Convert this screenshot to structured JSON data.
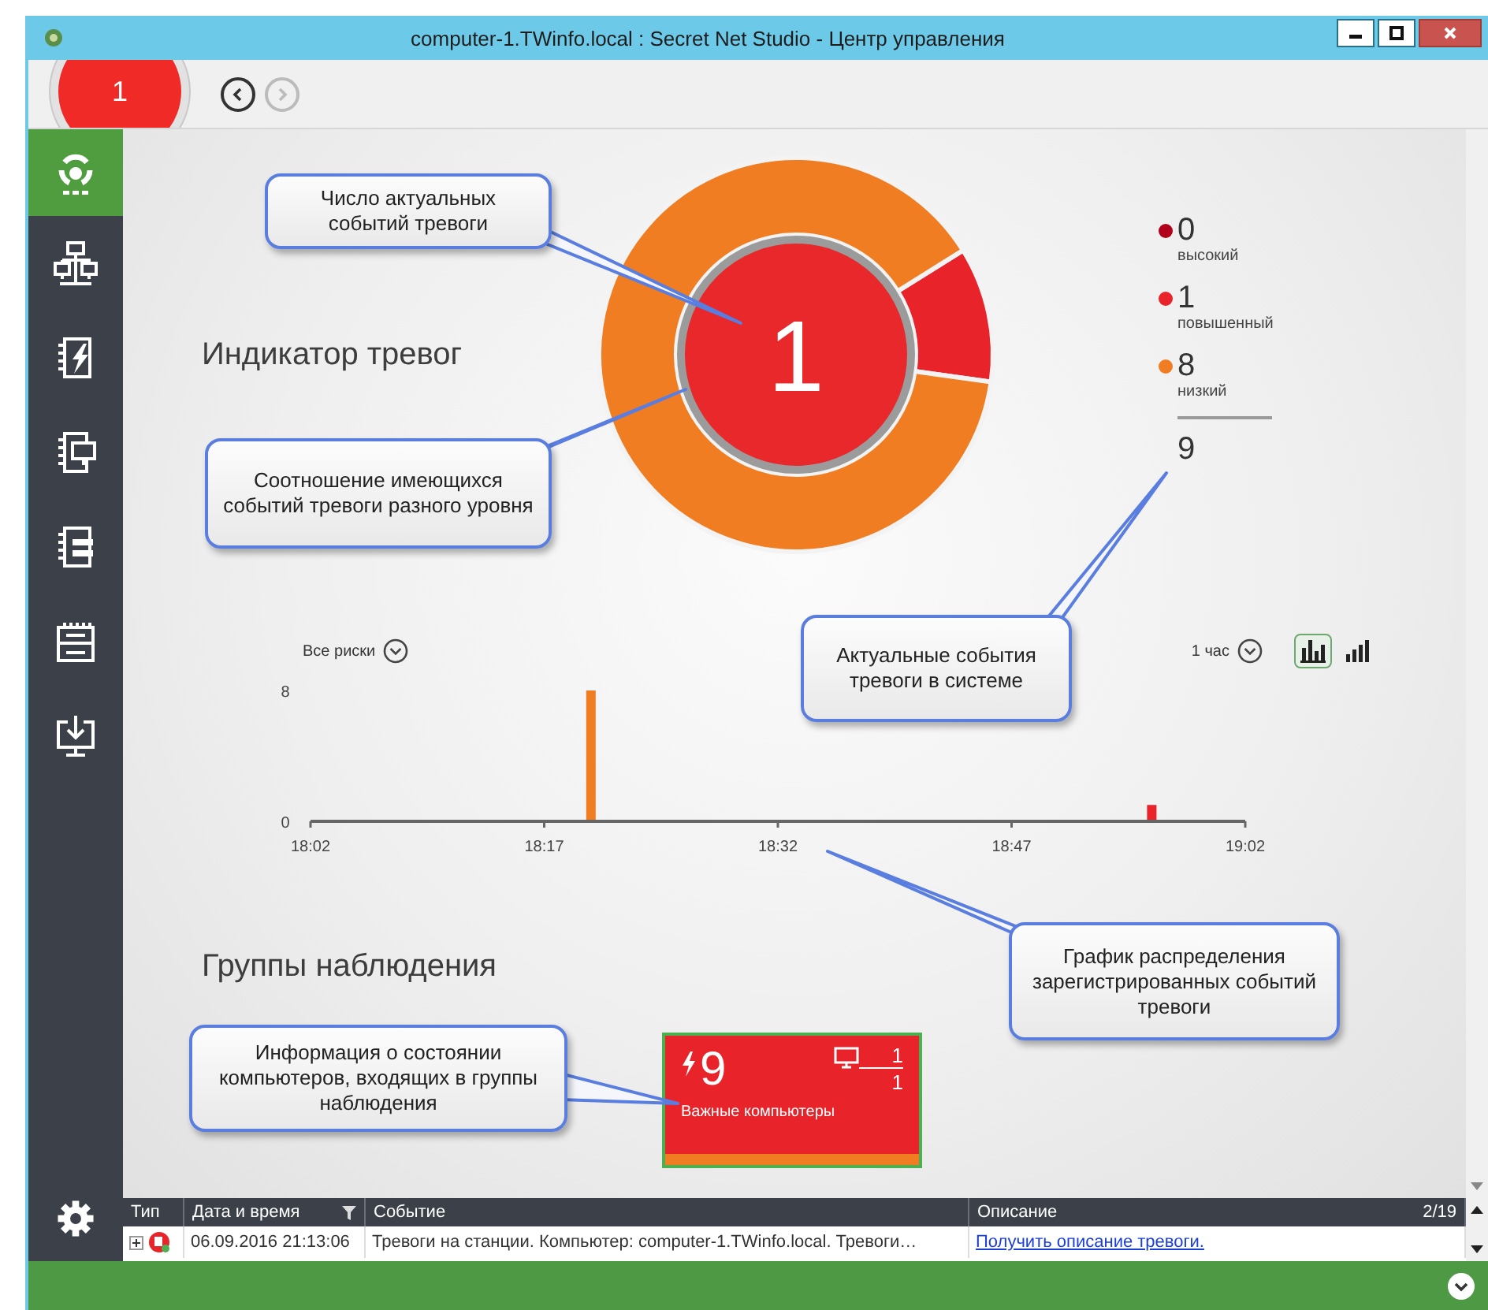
{
  "window": {
    "title": "computer-1.TWinfo.local : Secret Net Studio - Центр управления"
  },
  "toolbar": {
    "alarm_count": "1",
    "back_disabled": false,
    "forward_disabled": true
  },
  "sidebar": {
    "items": [
      {
        "kind": "dashboard",
        "selected": true
      },
      {
        "kind": "network",
        "selected": false
      },
      {
        "kind": "alarms",
        "selected": false
      },
      {
        "kind": "computers",
        "selected": false
      },
      {
        "kind": "journal",
        "selected": false
      },
      {
        "kind": "rack",
        "selected": false
      },
      {
        "kind": "install",
        "selected": false
      }
    ]
  },
  "indicator": {
    "title": "Индикатор тревог",
    "current_count": "1",
    "chart_data": {
      "type": "donut",
      "series": [
        {
          "values": [
            0,
            11.1,
            88.9
          ]
        }
      ]
    }
  },
  "legend": {
    "items": [
      {
        "count": "0",
        "label": "высокий",
        "color": "#b0001c"
      },
      {
        "count": "1",
        "label": "повышенный",
        "color": "#e8232a"
      },
      {
        "count": "8",
        "label": "низкий",
        "color": "#f07d22"
      }
    ],
    "total": "9"
  },
  "events_chart": {
    "risk_filter": "Все риски",
    "period": "1 час",
    "view_modes": [
      {
        "selected": true
      },
      {
        "selected": false
      }
    ],
    "chart_data": {
      "type": "bar",
      "categories": [
        "18:02",
        null,
        null,
        null,
        null,
        null,
        null,
        null,
        null,
        null,
        null,
        null,
        null,
        null,
        null,
        "18:17",
        null,
        null,
        null,
        null,
        null,
        null,
        null,
        null,
        null,
        null,
        null,
        null,
        null,
        null,
        "18:32",
        null,
        null,
        null,
        null,
        null,
        null,
        null,
        null,
        null,
        null,
        null,
        null,
        null,
        null,
        "18:47",
        null,
        null,
        null,
        null,
        null,
        null,
        null,
        null,
        null,
        null,
        null,
        null,
        null,
        null,
        "19:02"
      ],
      "series": [
        {
          "color": "#f07d22",
          "values": [
            null,
            null,
            null,
            null,
            null,
            null,
            null,
            null,
            null,
            null,
            null,
            null,
            null,
            null,
            null,
            null,
            null,
            null,
            8,
            null,
            null,
            null,
            null,
            null,
            null,
            null,
            null,
            null,
            null,
            null,
            null,
            null,
            null,
            null,
            null,
            null,
            null,
            null,
            null,
            null,
            null,
            null,
            null,
            null,
            null,
            null,
            null,
            null,
            null,
            null,
            null,
            null,
            null,
            null,
            null,
            null,
            null,
            null,
            null,
            null,
            null
          ]
        },
        {
          "color": "#e8232a",
          "values": [
            null,
            null,
            null,
            null,
            null,
            null,
            null,
            null,
            null,
            null,
            null,
            null,
            null,
            null,
            null,
            null,
            null,
            null,
            null,
            null,
            null,
            null,
            null,
            null,
            null,
            null,
            null,
            null,
            null,
            null,
            null,
            null,
            null,
            null,
            null,
            null,
            null,
            null,
            null,
            null,
            null,
            null,
            null,
            null,
            null,
            null,
            null,
            null,
            null,
            null,
            null,
            null,
            null,
            null,
            1,
            null,
            null,
            null,
            null,
            null,
            null
          ]
        }
      ],
      "ylim": [
        0,
        8
      ],
      "yticks": [
        0,
        8
      ],
      "stacked": true
    }
  },
  "groups": {
    "title": "Группы наблюдения",
    "tiles": [
      {
        "name": "Важные компьютеры",
        "alarms": "9",
        "computers_alarmed": "1",
        "computers_total": "1"
      }
    ]
  },
  "event_log": {
    "columns": [
      "Тип",
      "Дата и время",
      "Событие",
      "Описание"
    ],
    "page": "2/19",
    "rows": [
      {
        "expanded": false,
        "date": "06.09.2016 21:13:06",
        "event": "Тревоги на станции. Компьютер: computer-1.TWinfo.local. Тревоги…",
        "description": "Получить описание тревоги."
      }
    ]
  },
  "callouts": [
    {
      "text": "Число актуальных событий тревоги"
    },
    {
      "text": "Соотношение имеющихся событий тревоги разного уровня"
    },
    {
      "text": "Актуальные события тревоги в системе"
    },
    {
      "text": "График распределения зарегистрированных событий тревоги"
    },
    {
      "text": "Информация о состоянии компьютеров, входящих в группы наблюдения"
    }
  ]
}
